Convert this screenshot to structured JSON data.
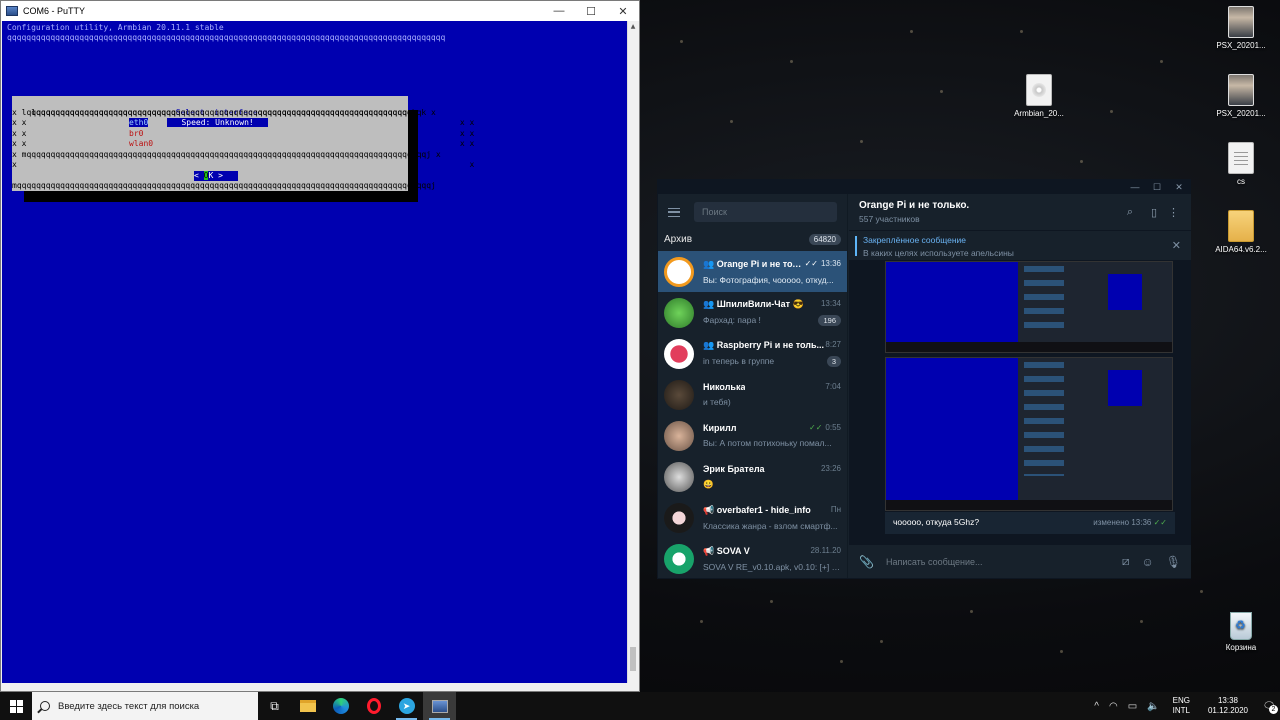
{
  "putty": {
    "title": "COM6 - PuTTY",
    "term_line1": "Configuration utility, Armbian 20.11.1 stable",
    "term_line2": "qqqqqqqqqqqqqqqqqqqqqqqqqqqqqqqqqqqqqqqqqqqqqqqqqqqqqqqqqqqqqqqqqqqqqqqqqqqqqqqqqqqqqqqqqqq",
    "dialog": {
      "top_left": "lqqqqqqqqqqqqqqqqqqqqqqqqqqqqq",
      "title": "Select  interface",
      "top_right": "qqqqqqqqqqqqqqqqqqqqqqqqqqqqqqqqk",
      "inner_top": "x lqqqqqqqqqqqqqqqqqqqqqqqqqqqqqqqqqqqqqqqqqqqqqqqqqqqqqqqqqqqqqqqqqqqqqqqqqqqqqqqqqqk x",
      "items": [
        "eth0",
        "br0",
        "wlan0"
      ],
      "speed": "   Speed: Unknown!   ",
      "bottom_sep": "x mqqqqqqqqqqqqqqqqqqqqqqqqqqqqqqqqqqqqqqqqqqqqqqqqqqqqqqqqqqqqqqqqqqqqqqqqqqqqqqqqqqqj x",
      "bottom": "mqqqqqqqqqqqqqqqqqqqqqqqqqqqqqqqqqqqqqqqqqqqqqqqqqqqqqqqqqqqqqqqqqqqqqqqqqqqqqqqqqqqqqqj",
      "ok_left": "< ",
      "ok_hl": "O",
      "ok_rest": "K >"
    }
  },
  "desktop": {
    "icons": [
      "PSX_20201...",
      "Armbian_20...",
      "PSX_20201...",
      "cs",
      "AIDA64.v6.2...",
      "Корзина"
    ]
  },
  "telegram": {
    "search_placeholder": "Поиск",
    "archive_label": "Архив",
    "archive_count": "64820",
    "chats": [
      {
        "title": "Orange Pi и не тольк...",
        "time": "13:36",
        "preview": "Вы: Фотография, чооооо, откуд...",
        "count": ""
      },
      {
        "title": "ШпилиВили-Чат 😎",
        "time": "13:34",
        "preview": "Фархад: пара !",
        "count": "196"
      },
      {
        "title": "Raspberry Pi и не толь...",
        "time": "8:27",
        "preview": "in теперь в группе",
        "count": "3"
      },
      {
        "title": "Николька",
        "time": "7:04",
        "preview": "и тебя)",
        "count": ""
      },
      {
        "title": "Кирилл",
        "time": "0:55",
        "preview": "Вы: А потом потихоньку помал...",
        "count": ""
      },
      {
        "title": "Эрик Братела",
        "time": "23:26",
        "preview": "😀",
        "count": ""
      },
      {
        "title": "overbafer1 - hide_info",
        "time": "Пн",
        "preview": "Классика жанра - взлом смартф...",
        "count": ""
      },
      {
        "title": "SOVA V",
        "time": "28.11.20",
        "preview": "SOVA V RE_v0.10.apk, v0.10: [+] П...",
        "count": ""
      }
    ],
    "chat_name": "Orange Pi и не только.",
    "members": "557 участников",
    "pinned_title": "Закреплённое сообщение",
    "pinned_text": "В каких целях используете апельсины",
    "message_text": "чооооо, откуда 5Ghz?",
    "message_meta": "изменено 13:36",
    "compose_placeholder": "Написать сообщение..."
  },
  "taskbar": {
    "search_placeholder": "Введите здесь текст для поиска",
    "lang_top": "ENG",
    "lang_bottom": "INTL",
    "time": "13:38",
    "date": "01.12.2020",
    "notif_count": "2"
  },
  "colors": {
    "putty_bg": "#0000b0",
    "telegram_active": "#2b5278",
    "telegram_bg": "#17212b"
  }
}
